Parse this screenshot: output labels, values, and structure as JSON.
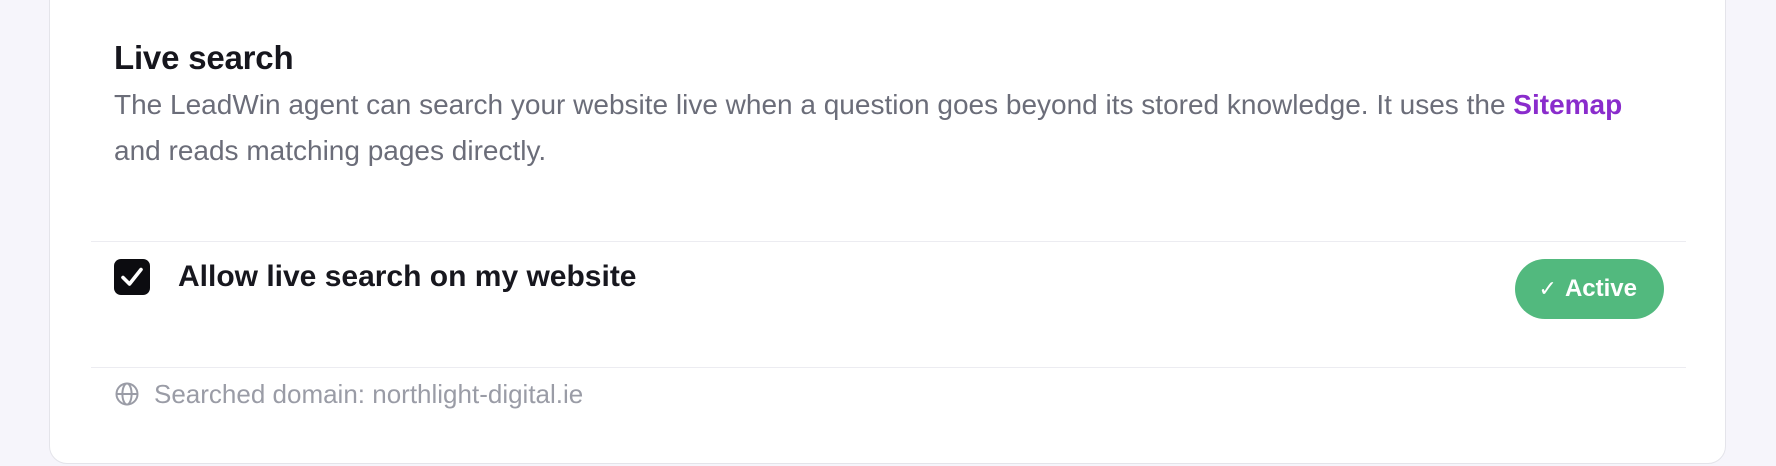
{
  "section": {
    "title": "Live search",
    "description_before_link": "The LeadWin agent can search your website live when a question goes beyond its stored knowledge. It uses the ",
    "description_link": "Sitemap",
    "description_after_link": " and reads matching pages directly."
  },
  "option": {
    "checked": true,
    "label": "Allow live search on my website",
    "status_label": "Active",
    "status_icon": "check-icon"
  },
  "domain": {
    "icon": "globe-icon",
    "text": "Searched domain: northlight-digital.ie"
  },
  "colors": {
    "accent_link": "#8a2ccc",
    "status_active": "#52b97e",
    "checkbox_fill": "#0c0c10"
  }
}
